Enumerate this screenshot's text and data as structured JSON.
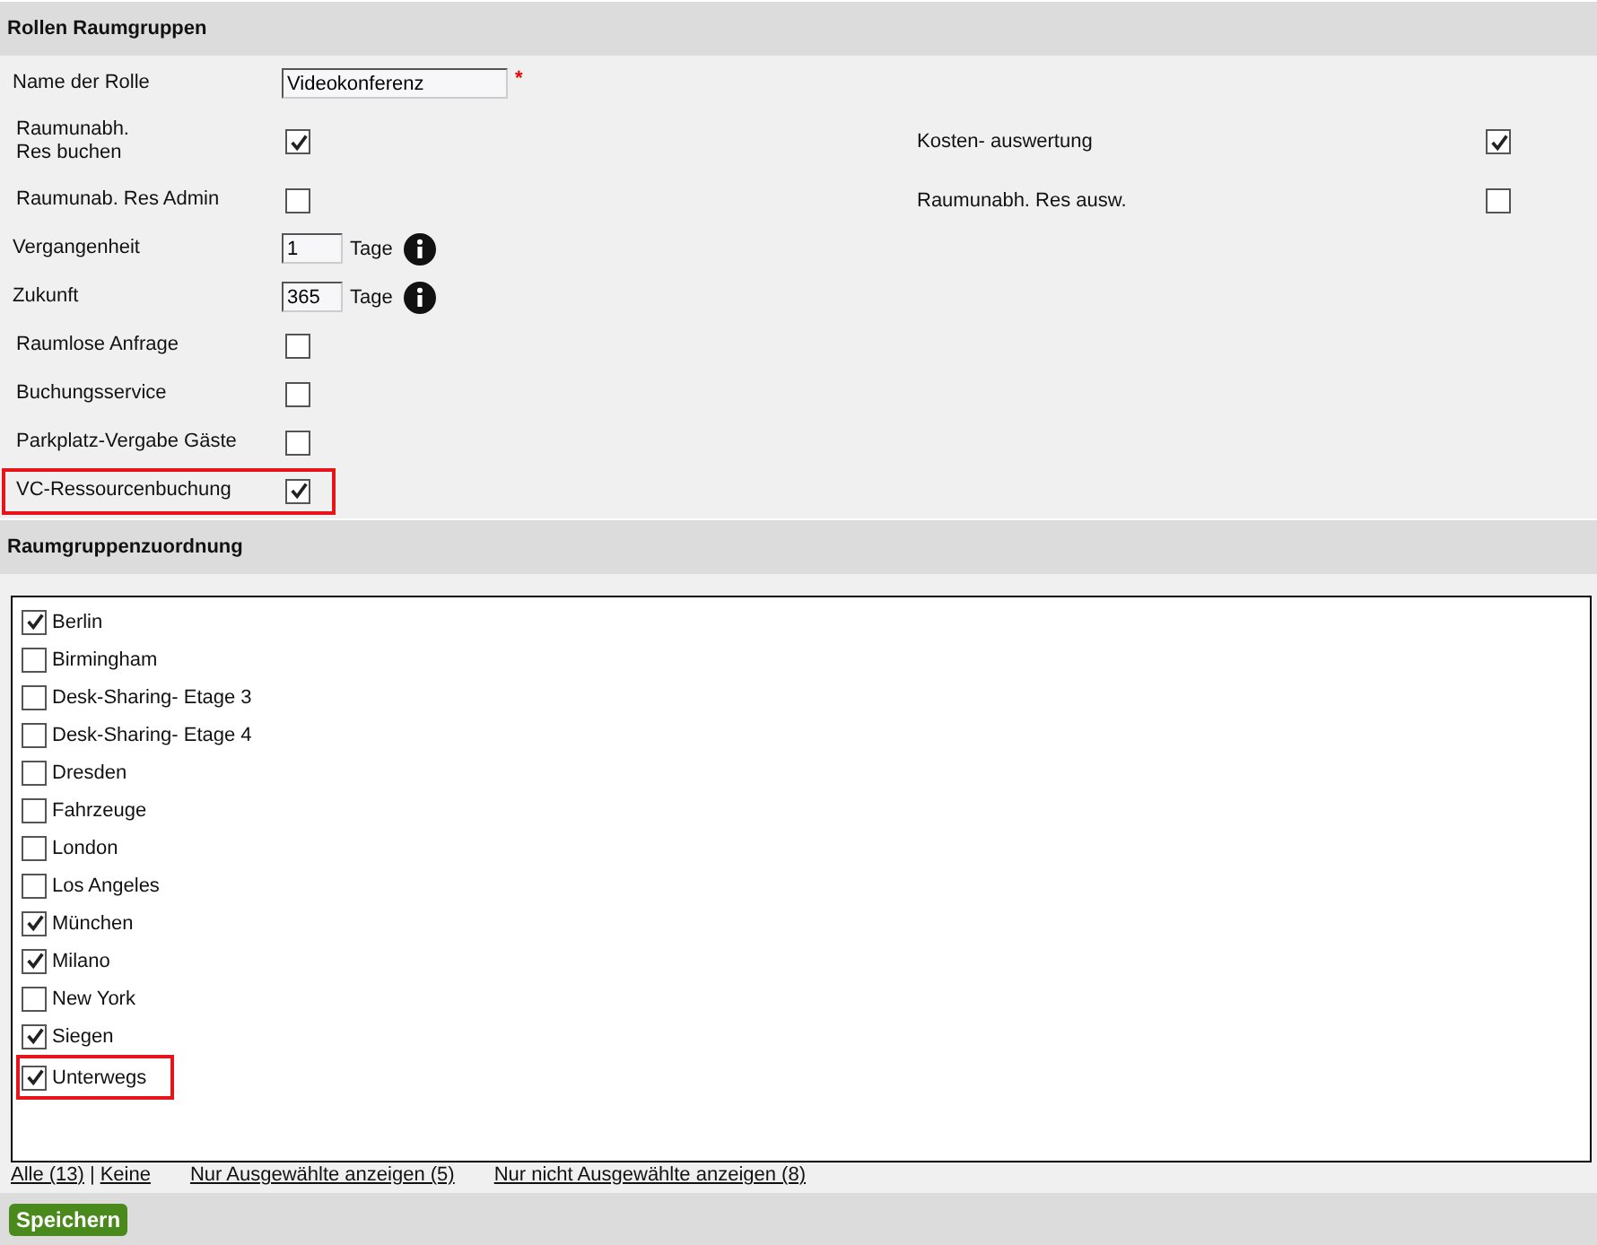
{
  "title": "Rollen Raumgruppen",
  "rows": [
    {
      "kind": "text",
      "label": "Name der Rolle",
      "value": "Videokonferenz",
      "required_mark": "*"
    },
    {
      "kind": "checkbox",
      "label": "Raumunabh.\nRes buchen",
      "checked": true,
      "highlighted": false,
      "right": {
        "label": "Kosten- auswertung",
        "checked": true
      }
    },
    {
      "kind": "checkbox",
      "label": "Raumunab. Res Admin",
      "checked": false,
      "highlighted": false,
      "right": {
        "label": "Raumunabh. Res ausw.",
        "checked": false
      }
    },
    {
      "kind": "number",
      "label": "Vergangenheit",
      "value": "1",
      "unit": "Tage"
    },
    {
      "kind": "number",
      "label": "Zukunft",
      "value": "365",
      "unit": "Tage"
    },
    {
      "kind": "checkbox",
      "label": "Raumlose Anfrage",
      "checked": false,
      "highlighted": false
    },
    {
      "kind": "checkbox",
      "label": "Buchungsservice",
      "checked": false,
      "highlighted": false
    },
    {
      "kind": "checkbox",
      "label": "Parkplatz-Vergabe Gäste",
      "checked": false,
      "highlighted": false
    },
    {
      "kind": "checkbox",
      "label": "VC-Ressourcenbuchung",
      "checked": true,
      "highlighted": true
    }
  ],
  "groups_title": "Raumgruppenzuordnung",
  "groups": [
    {
      "label": "Berlin",
      "checked": true,
      "highlighted": false
    },
    {
      "label": "Birmingham",
      "checked": false,
      "highlighted": false
    },
    {
      "label": "Desk-Sharing- Etage 3",
      "checked": false,
      "highlighted": false
    },
    {
      "label": "Desk-Sharing- Etage 4",
      "checked": false,
      "highlighted": false
    },
    {
      "label": "Dresden",
      "checked": false,
      "highlighted": false
    },
    {
      "label": "Fahrzeuge",
      "checked": false,
      "highlighted": false
    },
    {
      "label": "London",
      "checked": false,
      "highlighted": false
    },
    {
      "label": "Los Angeles",
      "checked": false,
      "highlighted": false
    },
    {
      "label": "München",
      "checked": true,
      "highlighted": false
    },
    {
      "label": "Milano",
      "checked": true,
      "highlighted": false
    },
    {
      "label": "New York",
      "checked": false,
      "highlighted": false
    },
    {
      "label": "Siegen",
      "checked": true,
      "highlighted": false
    },
    {
      "label": "Unterwegs",
      "checked": true,
      "highlighted": true
    }
  ],
  "links": {
    "all": "Alle (13)",
    "separator": "|",
    "none": "Keine",
    "selected": "Nur Ausgewählte anzeigen (5)",
    "unselected": "Nur nicht Ausgewählte anzeigen (8)"
  },
  "save_button": "Speichern"
}
